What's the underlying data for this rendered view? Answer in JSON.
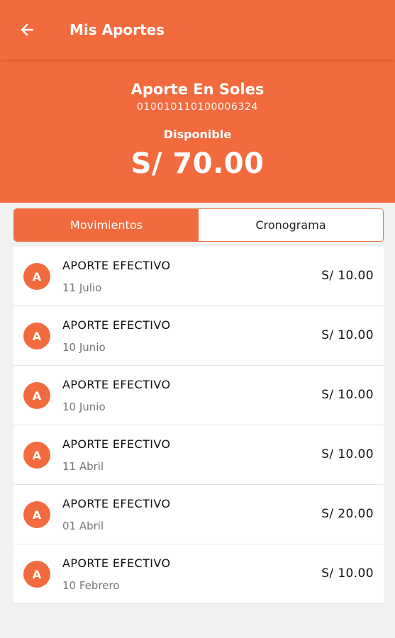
{
  "appbar": {
    "title": "Mis Aportes",
    "back_icon": "arrow-left-icon"
  },
  "account": {
    "name": "Aporte En Soles",
    "number": "010010110100006324",
    "available_label": "Disponible",
    "balance": "S/ 70.00"
  },
  "tabs": [
    {
      "label": "Movimientos",
      "active": true
    },
    {
      "label": "Cronograma",
      "active": false
    }
  ],
  "movements": [
    {
      "avatar": "A",
      "title": "APORTE EFECTIVO",
      "date": "11 Julio",
      "amount": "S/ 10.00"
    },
    {
      "avatar": "A",
      "title": "APORTE EFECTIVO",
      "date": "10 Junio",
      "amount": "S/ 10.00"
    },
    {
      "avatar": "A",
      "title": "APORTE EFECTIVO",
      "date": "10 Junio",
      "amount": "S/ 10.00"
    },
    {
      "avatar": "A",
      "title": "APORTE EFECTIVO",
      "date": "11 Abril",
      "amount": "S/ 10.00"
    },
    {
      "avatar": "A",
      "title": "APORTE EFECTIVO",
      "date": "01 Abril",
      "amount": "S/ 20.00"
    },
    {
      "avatar": "A",
      "title": "APORTE EFECTIVO",
      "date": "10 Febrero",
      "amount": "S/ 10.00"
    }
  ],
  "colors": {
    "accent": "#f26b3f",
    "background": "#f1f1f1"
  }
}
